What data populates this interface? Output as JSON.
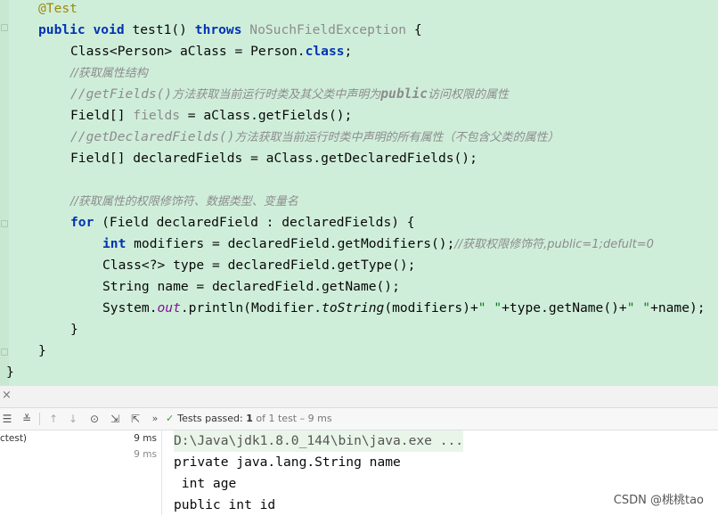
{
  "editor": {
    "lines": [
      {
        "annotation": "@Test"
      },
      {
        "kw1": "public",
        "kw2": "void",
        "name": "test1()",
        "kw3": "throws",
        "exc": "NoSuchFieldException",
        "brace": "{"
      },
      {
        "pre": "Class<Person> aClass = Person.",
        "kw": "class",
        "post": ";"
      },
      {
        "comment": "//获取属性结构"
      },
      {
        "c1": "//getFields()",
        "c2": "方法获取当前运行时类及其父类中声明为",
        "c3": "public",
        "c4": "访问权限的属性"
      },
      {
        "pre": "Field[] ",
        "unused": "fields",
        "post": " = aClass.getFields();"
      },
      {
        "c1": "//getDeclaredFields()",
        "c2": "方法获取当前运行时类中声明的所有属性（不包含父类的属性）"
      },
      {
        "text": "Field[] declaredFields = aClass.getDeclaredFields();"
      },
      {
        "comment": "//获取属性的权限修饰符、数据类型、变量名"
      },
      {
        "kw": "for",
        "text": " (Field declaredField : declaredFields) {"
      },
      {
        "kw": "int",
        "text": " modifiers = declaredField.getModifiers();",
        "comment": "//获取权限修饰符,public=1;defult=0"
      },
      {
        "text": "Class<?> type = declaredField.getType();"
      },
      {
        "text": "String name = declaredField.getName();"
      },
      {
        "p1": "System.",
        "out": "out",
        "p2": ".println(Modifier.",
        "toString": "toString",
        "p3": "(modifiers)+",
        "s1": "\" \"",
        "p4": "+type.getName()+",
        "s2": "\" \"",
        "p5": "+name);"
      },
      {
        "text": "}"
      },
      {
        "text": "}"
      },
      {
        "text": "}"
      }
    ]
  },
  "tool_window": {
    "close_label": "×",
    "toolbar": {
      "icons": [
        "expand-all-icon",
        "collapse-all-icon",
        "previous-test-icon",
        "next-test-icon",
        "history-icon",
        "import-tests-icon",
        "export-tests-icon",
        "more-icon"
      ],
      "status": {
        "passed_label": "Tests passed:",
        "passed_count": "1",
        "detail": " of 1 test – 9 ms"
      }
    },
    "tree": [
      {
        "label": "ctest)",
        "time": "9 ms"
      },
      {
        "label": "",
        "time": "9 ms"
      }
    ],
    "console": [
      "D:\\Java\\jdk1.8.0_144\\bin\\java.exe ...",
      "private java.lang.String name",
      " int age",
      "public int id"
    ]
  },
  "watermark": "CSDN @桃桃tao",
  "colors": {
    "editor_bg": "#cfeeda",
    "keyword": "#0033b3",
    "comment": "#8c8c8c",
    "string": "#067d17",
    "field": "#871094",
    "annotation": "#9e880d",
    "passed": "#3c9a3c"
  }
}
